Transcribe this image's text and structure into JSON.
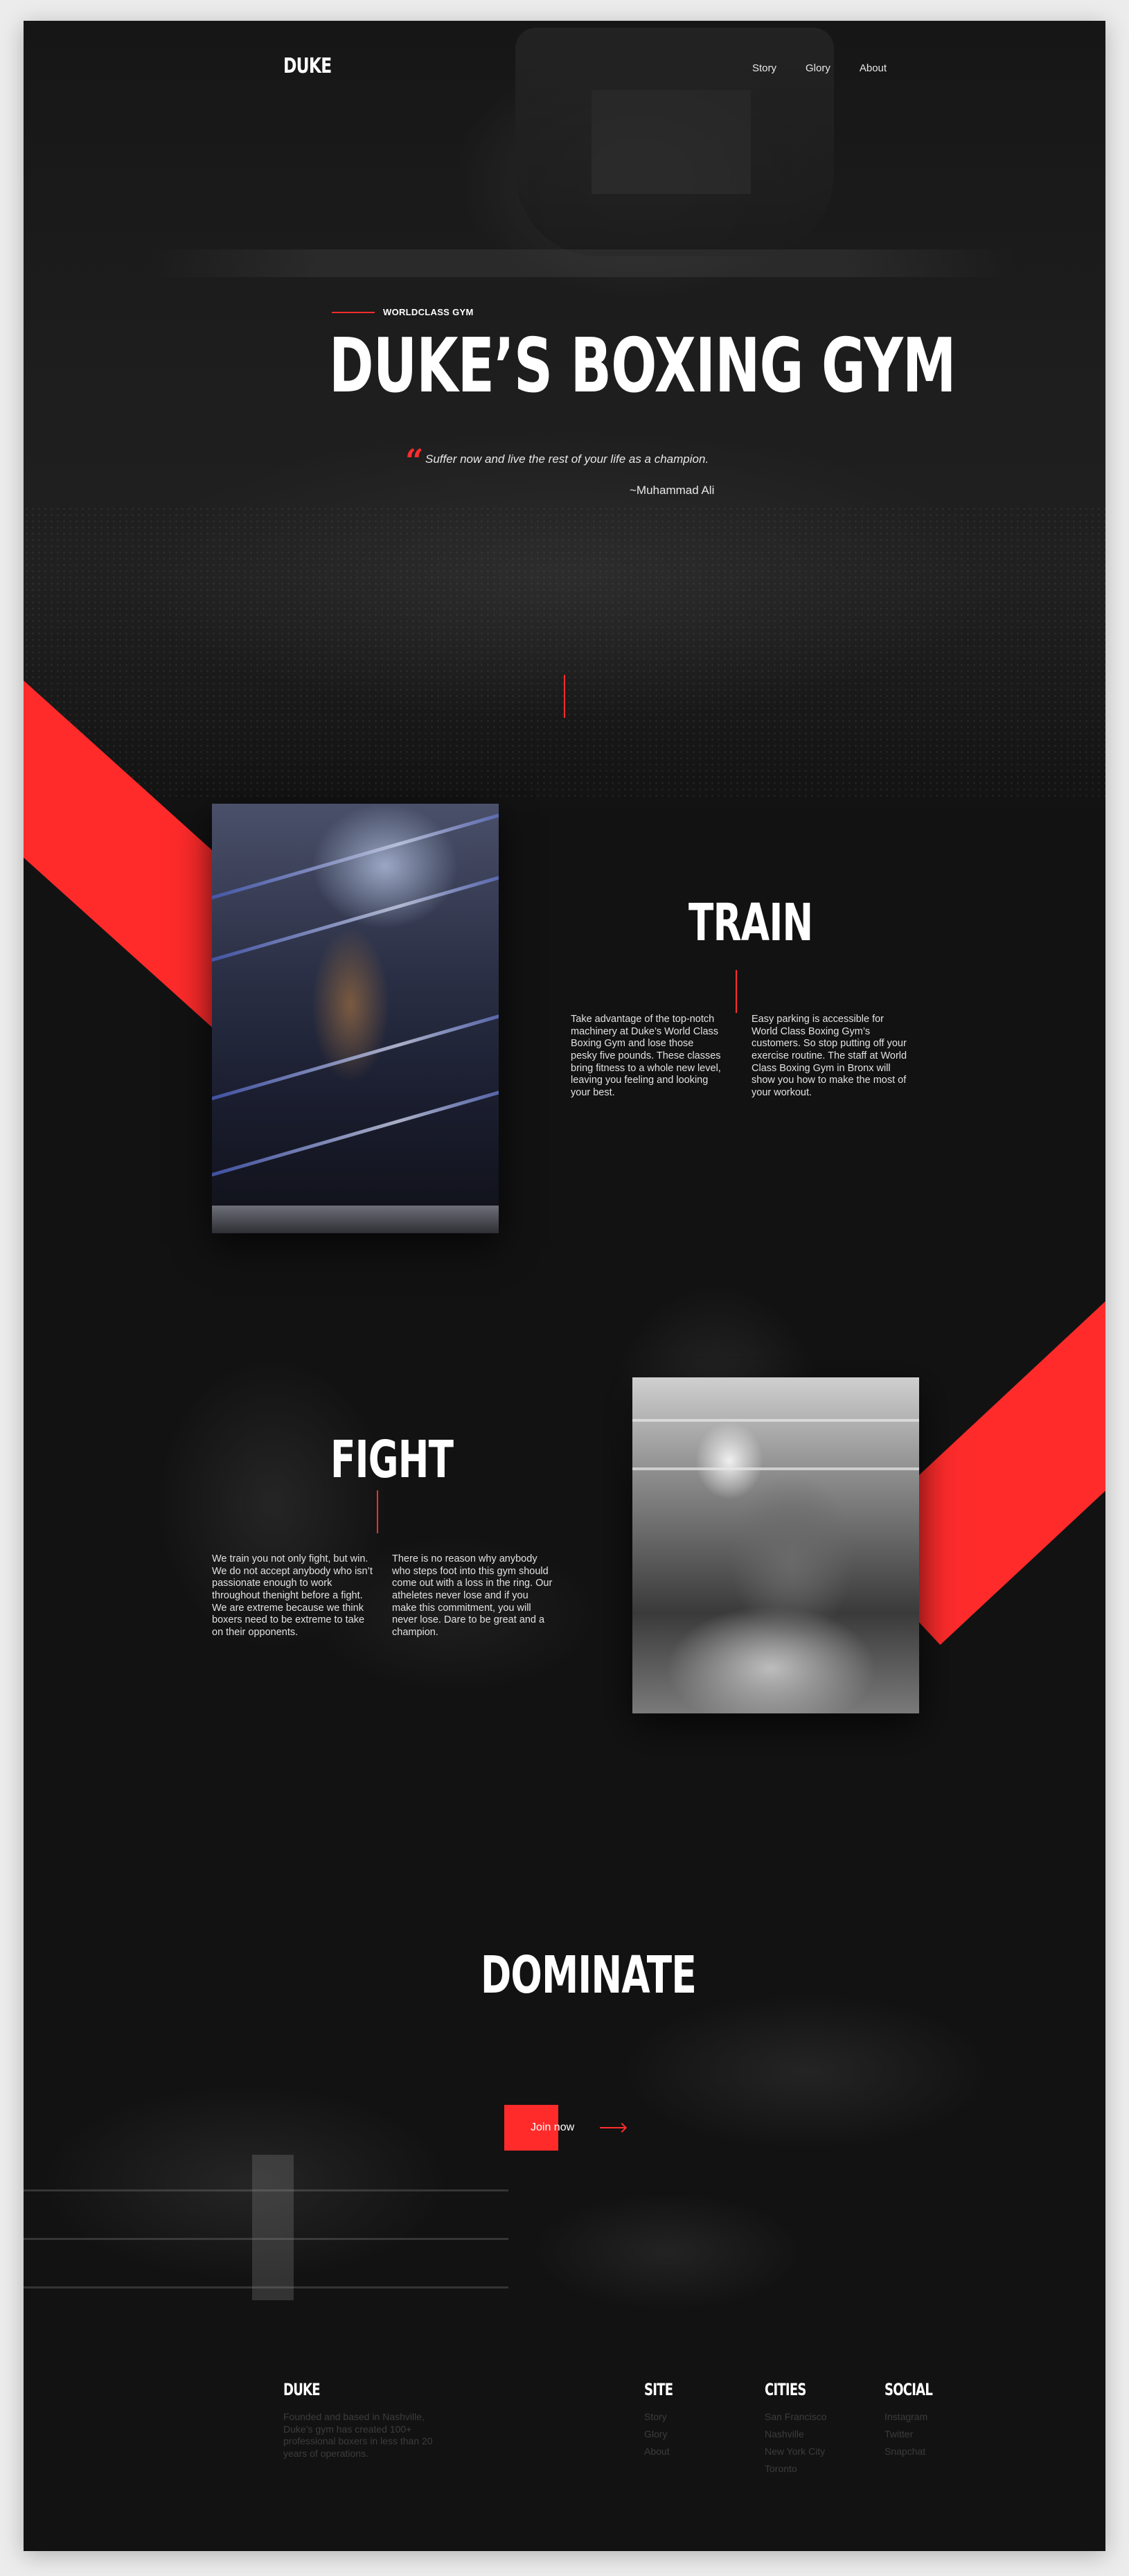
{
  "brand": {
    "logo": "DUKE",
    "accent_color": "#ff2b2b",
    "background": "#121212"
  },
  "nav": {
    "items": [
      "Story",
      "Glory",
      "About"
    ]
  },
  "hero": {
    "eyebrow": "WORLDCLASS GYM",
    "title": "DUKE’S BOXING GYM",
    "quote_mark": "“",
    "quote": "Suffer now and live the rest of your life as a champion.",
    "author": "~Muhammad Ali"
  },
  "train": {
    "title": "TRAIN",
    "col1": "Take advantage of the top-notch machinery at Duke’s World Class Boxing Gym and lose those pesky five pounds. These classes bring fitness to a whole new level, leaving you feeling and looking your best.",
    "col2": "Easy parking is accessible for World Class Boxing Gym’s customers. So stop putting off your exercise routine. The staff at World Class Boxing Gym in Bronx will show you how to make the most of your workout."
  },
  "fight": {
    "title": "FIGHT",
    "col1": "We train you not only fight, but win. We do not accept anybody who isn’t passionate enough to work throughout thenight before a fight. We are extreme because we think boxers need to be extreme to take on their opponents.",
    "col2": "There is no reason why anybody who steps foot into this gym should come out with a loss in the ring. Our atheletes never lose and if you make this commitment, you will never lose. Dare to be great and a champion."
  },
  "dominate": {
    "title": "DOMINATE",
    "cta": "Join now"
  },
  "footer": {
    "brand": "DUKE",
    "about": "Founded and based in Nashville, Duke’s gym has created 100+ professional boxers in less than 20 years of operations.",
    "site": {
      "title": "SITE",
      "links": [
        "Story",
        "Glory",
        "About"
      ]
    },
    "cities": {
      "title": "CITIES",
      "links": [
        "San Francisco",
        "Nashville",
        "New York City",
        "Toronto"
      ]
    },
    "social": {
      "title": "SOCIAL",
      "links": [
        "Instagram",
        "Twitter",
        "Snapchat"
      ]
    }
  }
}
